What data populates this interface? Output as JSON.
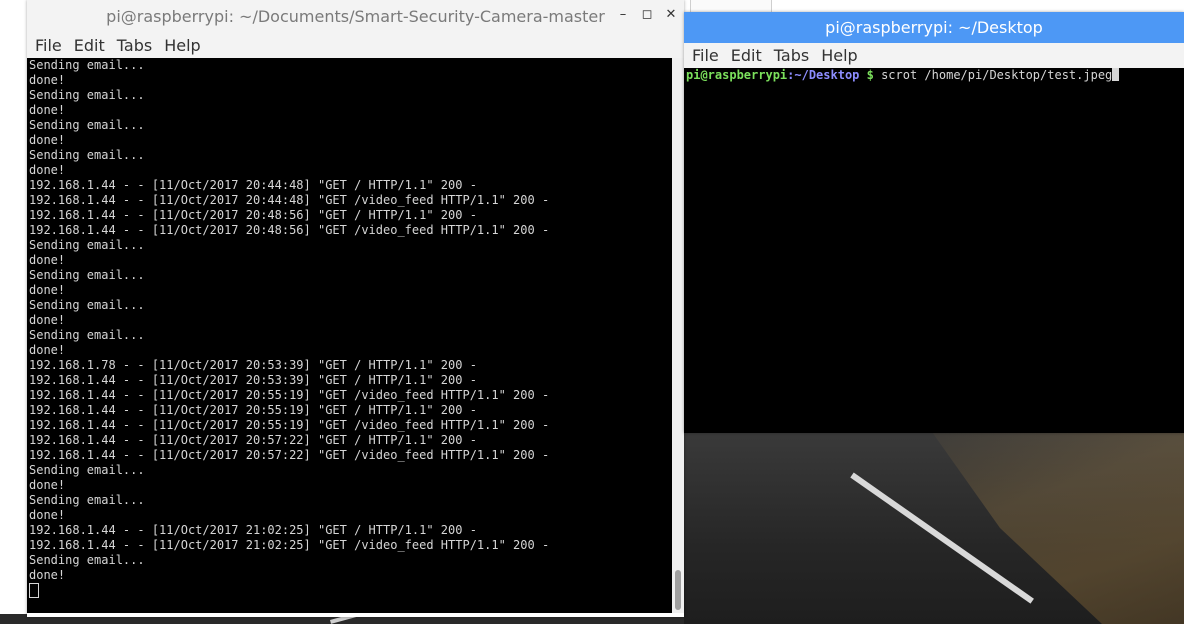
{
  "left_terminal": {
    "title": "pi@raspberrypi: ~/Documents/Smart-Security-Camera-master",
    "menu": [
      "File",
      "Edit",
      "Tabs",
      "Help"
    ],
    "lines": [
      "Sending email...",
      "done!",
      "Sending email...",
      "done!",
      "Sending email...",
      "done!",
      "Sending email...",
      "done!",
      "192.168.1.44 - - [11/Oct/2017 20:44:48] \"GET / HTTP/1.1\" 200 -",
      "192.168.1.44 - - [11/Oct/2017 20:44:48] \"GET /video_feed HTTP/1.1\" 200 -",
      "192.168.1.44 - - [11/Oct/2017 20:48:56] \"GET / HTTP/1.1\" 200 -",
      "192.168.1.44 - - [11/Oct/2017 20:48:56] \"GET /video_feed HTTP/1.1\" 200 -",
      "Sending email...",
      "done!",
      "Sending email...",
      "done!",
      "Sending email...",
      "done!",
      "Sending email...",
      "done!",
      "192.168.1.78 - - [11/Oct/2017 20:53:39] \"GET / HTTP/1.1\" 200 -",
      "192.168.1.44 - - [11/Oct/2017 20:53:39] \"GET / HTTP/1.1\" 200 -",
      "192.168.1.44 - - [11/Oct/2017 20:55:19] \"GET /video_feed HTTP/1.1\" 200 -",
      "192.168.1.44 - - [11/Oct/2017 20:55:19] \"GET / HTTP/1.1\" 200 -",
      "192.168.1.44 - - [11/Oct/2017 20:55:19] \"GET /video_feed HTTP/1.1\" 200 -",
      "192.168.1.44 - - [11/Oct/2017 20:57:22] \"GET / HTTP/1.1\" 200 -",
      "192.168.1.44 - - [11/Oct/2017 20:57:22] \"GET /video_feed HTTP/1.1\" 200 -",
      "Sending email...",
      "done!",
      "Sending email...",
      "done!",
      "192.168.1.44 - - [11/Oct/2017 21:02:25] \"GET / HTTP/1.1\" 200 -",
      "192.168.1.44 - - [11/Oct/2017 21:02:25] \"GET /video_feed HTTP/1.1\" 200 -",
      "Sending email...",
      "done!"
    ]
  },
  "right_terminal": {
    "title": "pi@raspberrypi: ~/Desktop",
    "menu": [
      "File",
      "Edit",
      "Tabs",
      "Help"
    ],
    "prompt_user": "pi@raspberrypi",
    "prompt_path": ":~/Desktop",
    "prompt_symbol": " $",
    "command": " scrot /home/pi/Desktop/test.jpeg"
  },
  "window_controls": {
    "minimize": "–",
    "maximize": "◻",
    "close": "✕"
  }
}
